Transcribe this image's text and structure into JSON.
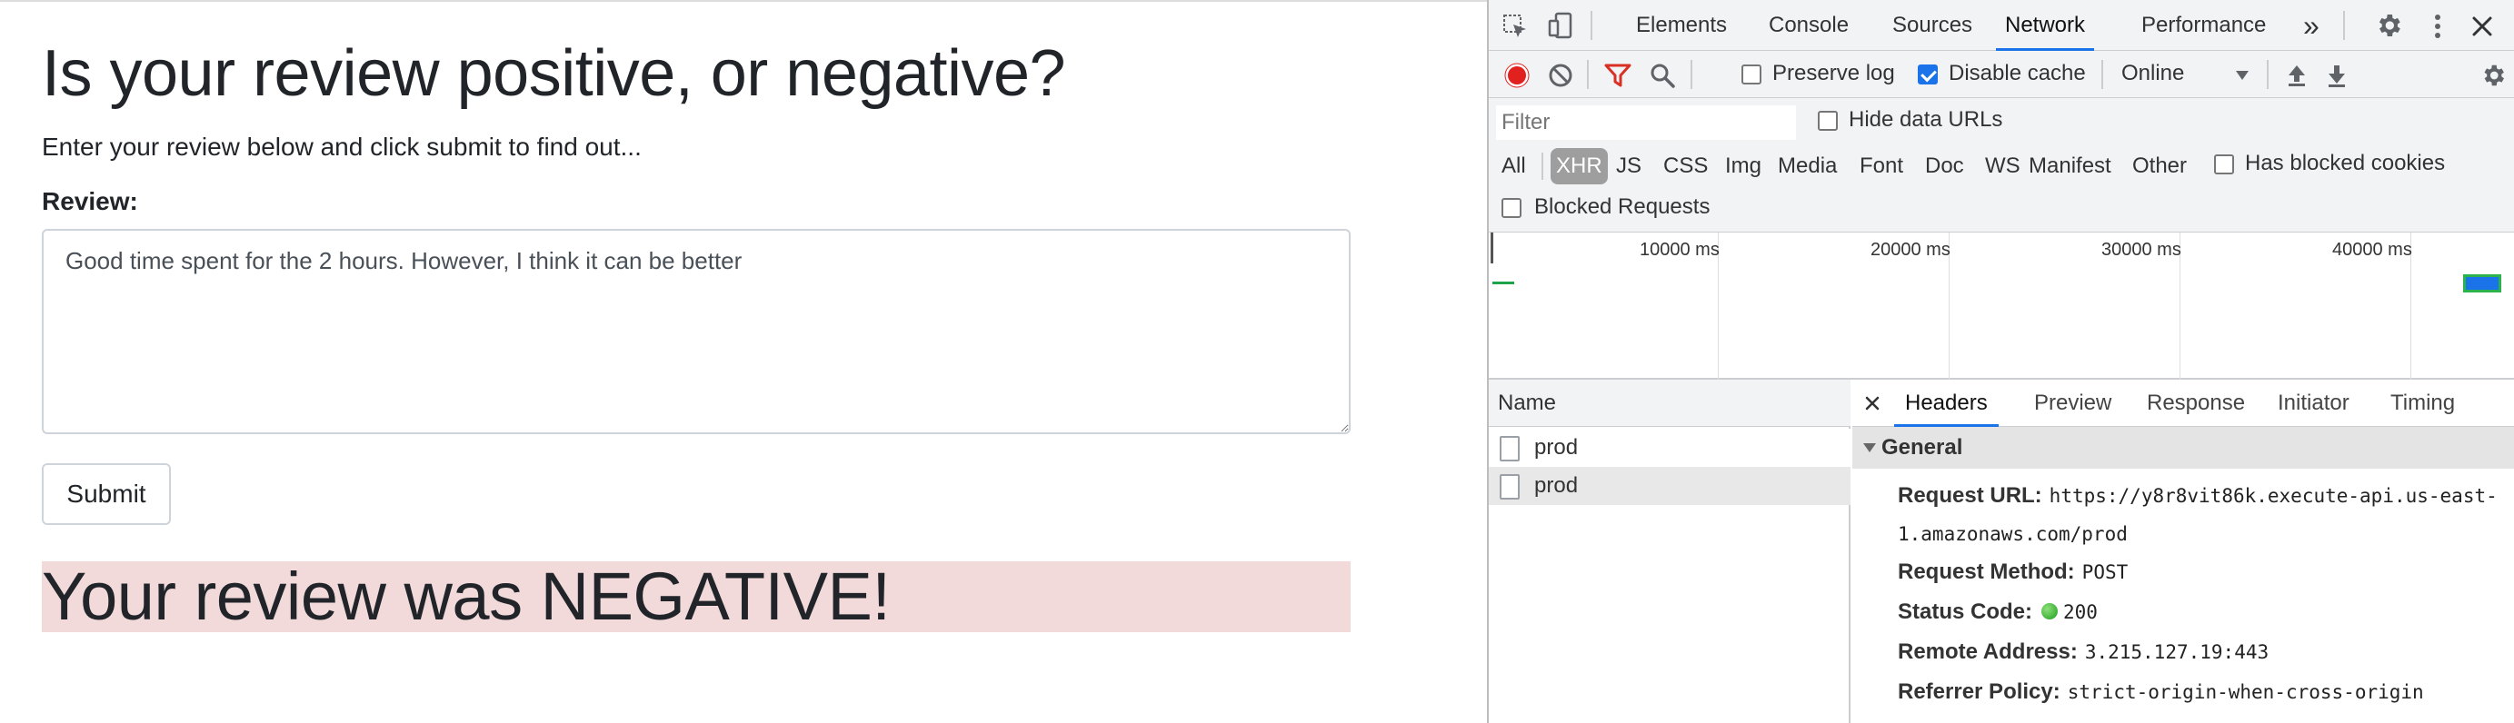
{
  "page": {
    "title": "Is your review positive, or negative?",
    "description": "Enter your review below and click submit to find out...",
    "review_label": "Review:",
    "review_value": "Good time spent for the 2 hours. However, I think it can be better",
    "submit_label": "Submit",
    "result": "Your review was NEGATIVE!"
  },
  "devtools": {
    "tabs": [
      {
        "label": "Elements"
      },
      {
        "label": "Console"
      },
      {
        "label": "Sources"
      },
      {
        "label": "Network",
        "active": true
      },
      {
        "label": "Performance"
      }
    ],
    "more_tabs": "»",
    "toolbar": {
      "preserve_log": "Preserve log",
      "preserve_log_checked": false,
      "disable_cache": "Disable cache",
      "disable_cache_checked": true,
      "throttling": "Online"
    },
    "filter": {
      "placeholder": "Filter",
      "hide_data_urls": "Hide data URLs",
      "types": [
        "All",
        "XHR",
        "JS",
        "CSS",
        "Img",
        "Media",
        "Font",
        "Doc",
        "WS",
        "Manifest",
        "Other"
      ],
      "active_type": "XHR",
      "has_blocked_cookies": "Has blocked cookies",
      "blocked_requests": "Blocked Requests"
    },
    "timeline_ticks": [
      "10000 ms",
      "20000 ms",
      "30000 ms",
      "40000 ms"
    ],
    "requests": {
      "name_header": "Name",
      "rows": [
        {
          "name": "prod"
        },
        {
          "name": "prod"
        }
      ]
    },
    "details": {
      "tabs": [
        "Headers",
        "Preview",
        "Response",
        "Initiator",
        "Timing"
      ],
      "active_tab": "Headers",
      "section": "General",
      "request_url_label": "Request URL:",
      "request_url_value": "https://y8r8vit86k.execute-api.us-east-",
      "request_url_value_cont": "1.amazonaws.com/prod",
      "request_method_label": "Request Method:",
      "request_method_value": "POST",
      "status_code_label": "Status Code:",
      "status_code_value": "200",
      "remote_address_label": "Remote Address:",
      "remote_address_value": "3.215.127.19:443",
      "referrer_policy_label": "Referrer Policy:",
      "referrer_policy_value": "strict-origin-when-cross-origin"
    }
  },
  "colors": {
    "result_bg": "#f2d9da",
    "accent": "#1a73e8",
    "record": "#e0211d",
    "filter_icon": "#d93025",
    "status_ok": "#1e9e1e"
  }
}
